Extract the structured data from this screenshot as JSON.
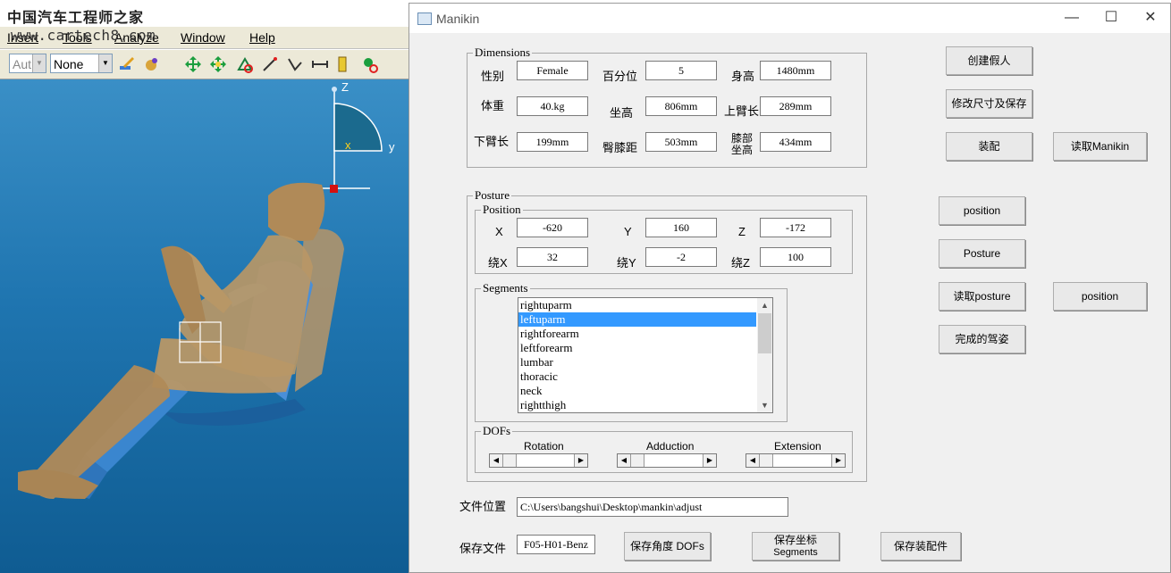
{
  "background_app": {
    "logo_text": "中国汽车工程师之家",
    "watermark": "www.cartech8.com",
    "menu": [
      "Insert",
      "Tools",
      "Analyze",
      "Window",
      "Help"
    ],
    "toolbar": {
      "combo1": "Aut",
      "combo2": "None"
    },
    "axes": {
      "z": "Z",
      "y": "y",
      "x": "x"
    }
  },
  "dialog": {
    "title": "Manikin",
    "window_controls": {
      "minimize": "—",
      "maximize": "☐",
      "close": "✕"
    },
    "dimensions": {
      "legend": "Dimensions",
      "gender_label": "性别",
      "gender_value": "Female",
      "percentile_label": "百分位",
      "percentile_value": "5",
      "height_label": "身高",
      "height_value": "1480mm",
      "weight_label": "体重",
      "weight_value": "40.kg",
      "sitting_height_label": "坐高",
      "sitting_height_value": "806mm",
      "upper_arm_label": "上臂长",
      "upper_arm_value": "289mm",
      "forearm_label": "下臂长",
      "forearm_value": "199mm",
      "hip_knee_label": "臀膝距",
      "hip_knee_value": "503mm",
      "knee_height_label_1": "膝部",
      "knee_height_label_2": "坐高",
      "knee_height_value": "434mm"
    },
    "posture": {
      "legend": "Posture",
      "position_legend": "Position",
      "x_label": "X",
      "x_value": "-620",
      "y_label": "Y",
      "y_value": "160",
      "z_label": "Z",
      "z_value": "-172",
      "rx_label": "绕X",
      "rx_value": "32",
      "ry_label": "绕Y",
      "ry_value": "-2",
      "rz_label": "绕Z",
      "rz_value": "100",
      "segments_legend": "Segments",
      "segments": [
        "rightuparm",
        "leftuparm",
        "rightforearm",
        "leftforearm",
        "lumbar",
        "thoracic",
        "neck",
        "rightthigh"
      ],
      "selected_segment": "leftuparm",
      "dofs_legend": "DOFs",
      "rotation_label": "Rotation",
      "adduction_label": "Adduction",
      "extension_label": "Extension"
    },
    "buttons": {
      "create_manikin": "创建假人",
      "modify_save": "修改尺寸及保存",
      "assemble": "装配",
      "read_manikin": "读取Manikin",
      "position": "position",
      "posture": "Posture",
      "read_posture": "读取posture",
      "position2": "position",
      "complete_posture": "完成的驾姿",
      "save_dofs": "保存角度 DOFs",
      "save_coords_1": "保存坐标",
      "save_coords_2": "Segments",
      "save_assembly": "保存装配件"
    },
    "file_location_label": "文件位置",
    "file_location_value": "C:\\Users\\bangshui\\Desktop\\mankin\\adjust",
    "save_file_label": "保存文件",
    "save_file_value": "F05-H01-Benz"
  }
}
